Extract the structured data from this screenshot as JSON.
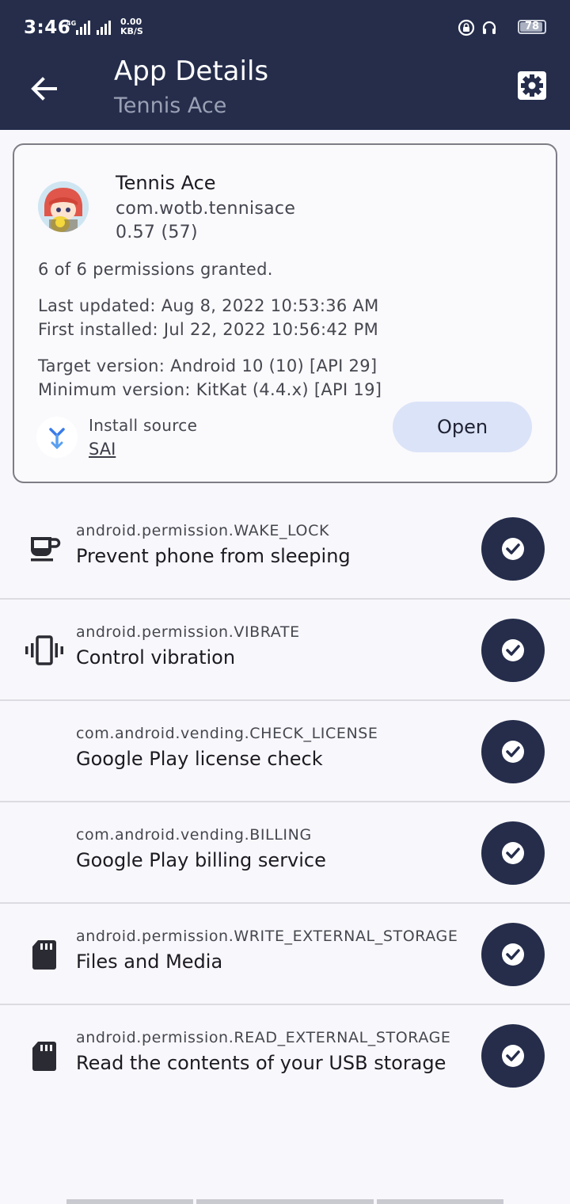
{
  "status_bar": {
    "time": "3:46",
    "net_speed_value": "0.00",
    "net_speed_unit": "KB/S",
    "network_label": "4G",
    "battery": "78"
  },
  "app_bar": {
    "title": "App Details",
    "subtitle": "Tennis Ace",
    "back_icon": "arrow-back-icon",
    "settings_icon": "gear-icon"
  },
  "app_info": {
    "name": "Tennis Ace",
    "package": "com.wotb.tennisace",
    "version": "0.57 (57)",
    "permissions_summary": "6 of 6 permissions granted.",
    "last_updated": "Last updated: Aug 8, 2022 10:53:36 AM",
    "first_installed": "First installed: Jul 22, 2022 10:56:42 PM",
    "target_version": "Target version: Android 10 (10) [API 29]",
    "minimum_version": "Minimum version: KitKat (4.4.x) [API 19]",
    "install_source_label": "Install source",
    "install_source_value": "SAI",
    "open_label": "Open"
  },
  "permissions": [
    {
      "id": "android.permission.WAKE_LOCK",
      "desc": "Prevent phone from sleeping",
      "icon": "coffee-cup-icon",
      "granted": true
    },
    {
      "id": "android.permission.VIBRATE",
      "desc": "Control vibration",
      "icon": "vibration-icon",
      "granted": true
    },
    {
      "id": "com.android.vending.CHECK_LICENSE",
      "desc": "Google Play license check",
      "icon": "",
      "granted": true
    },
    {
      "id": "com.android.vending.BILLING",
      "desc": "Google Play billing service",
      "icon": "",
      "granted": true
    },
    {
      "id": "android.permission.WRITE_EXTERNAL_STORAGE",
      "desc": "Files and Media",
      "icon": "sd-card-icon",
      "granted": true
    },
    {
      "id": "android.permission.READ_EXTERNAL_STORAGE",
      "desc": "Read the contents of your USB storage",
      "icon": "sd-card-icon",
      "granted": true
    }
  ],
  "colors": {
    "app_bar": "#252d4b",
    "check_badge": "#252d4b",
    "open_button": "#dbe3f8"
  }
}
